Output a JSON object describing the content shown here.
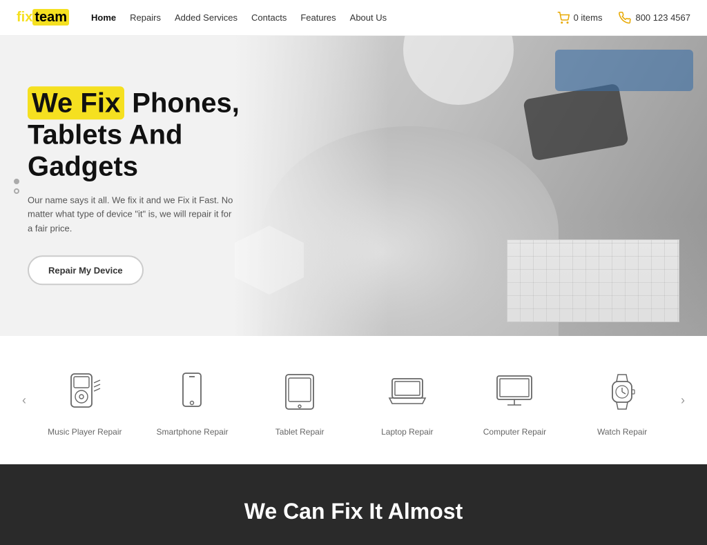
{
  "brand": {
    "name_pre": "fix",
    "name_post": "team"
  },
  "nav": {
    "links": [
      {
        "label": "Home",
        "active": true
      },
      {
        "label": "Repairs",
        "active": false
      },
      {
        "label": "Added Services",
        "active": false
      },
      {
        "label": "Contacts",
        "active": false
      },
      {
        "label": "Features",
        "active": false
      },
      {
        "label": "About Us",
        "active": false
      }
    ]
  },
  "header": {
    "cart_label": "0 items",
    "phone_label": "800 123 4567"
  },
  "hero": {
    "title_highlight": "We Fix",
    "title_rest": " Phones,",
    "title_line2": "Tablets And",
    "title_line3": "Gadgets",
    "subtitle": "Our name says it all. We fix it and we Fix it Fast. No matter what type of device \"it\" is, we will repair it for a fair price.",
    "cta_label": "Repair My Device"
  },
  "services": {
    "prev_label": "‹",
    "next_label": "›",
    "items": [
      {
        "id": "music",
        "label": "Music Player Repair",
        "icon": "music-player"
      },
      {
        "id": "smartphone",
        "label": "Smartphone Repair",
        "icon": "smartphone"
      },
      {
        "id": "tablet",
        "label": "Tablet Repair",
        "icon": "tablet"
      },
      {
        "id": "laptop",
        "label": "Laptop Repair",
        "icon": "laptop"
      },
      {
        "id": "computer",
        "label": "Computer Repair",
        "icon": "computer"
      },
      {
        "id": "watch",
        "label": "Watch Repair",
        "icon": "watch"
      }
    ]
  },
  "footer": {
    "title": "We Can Fix It Almost"
  },
  "colors": {
    "accent": "#f5e020",
    "dark": "#2a2a2a",
    "text": "#333333"
  }
}
